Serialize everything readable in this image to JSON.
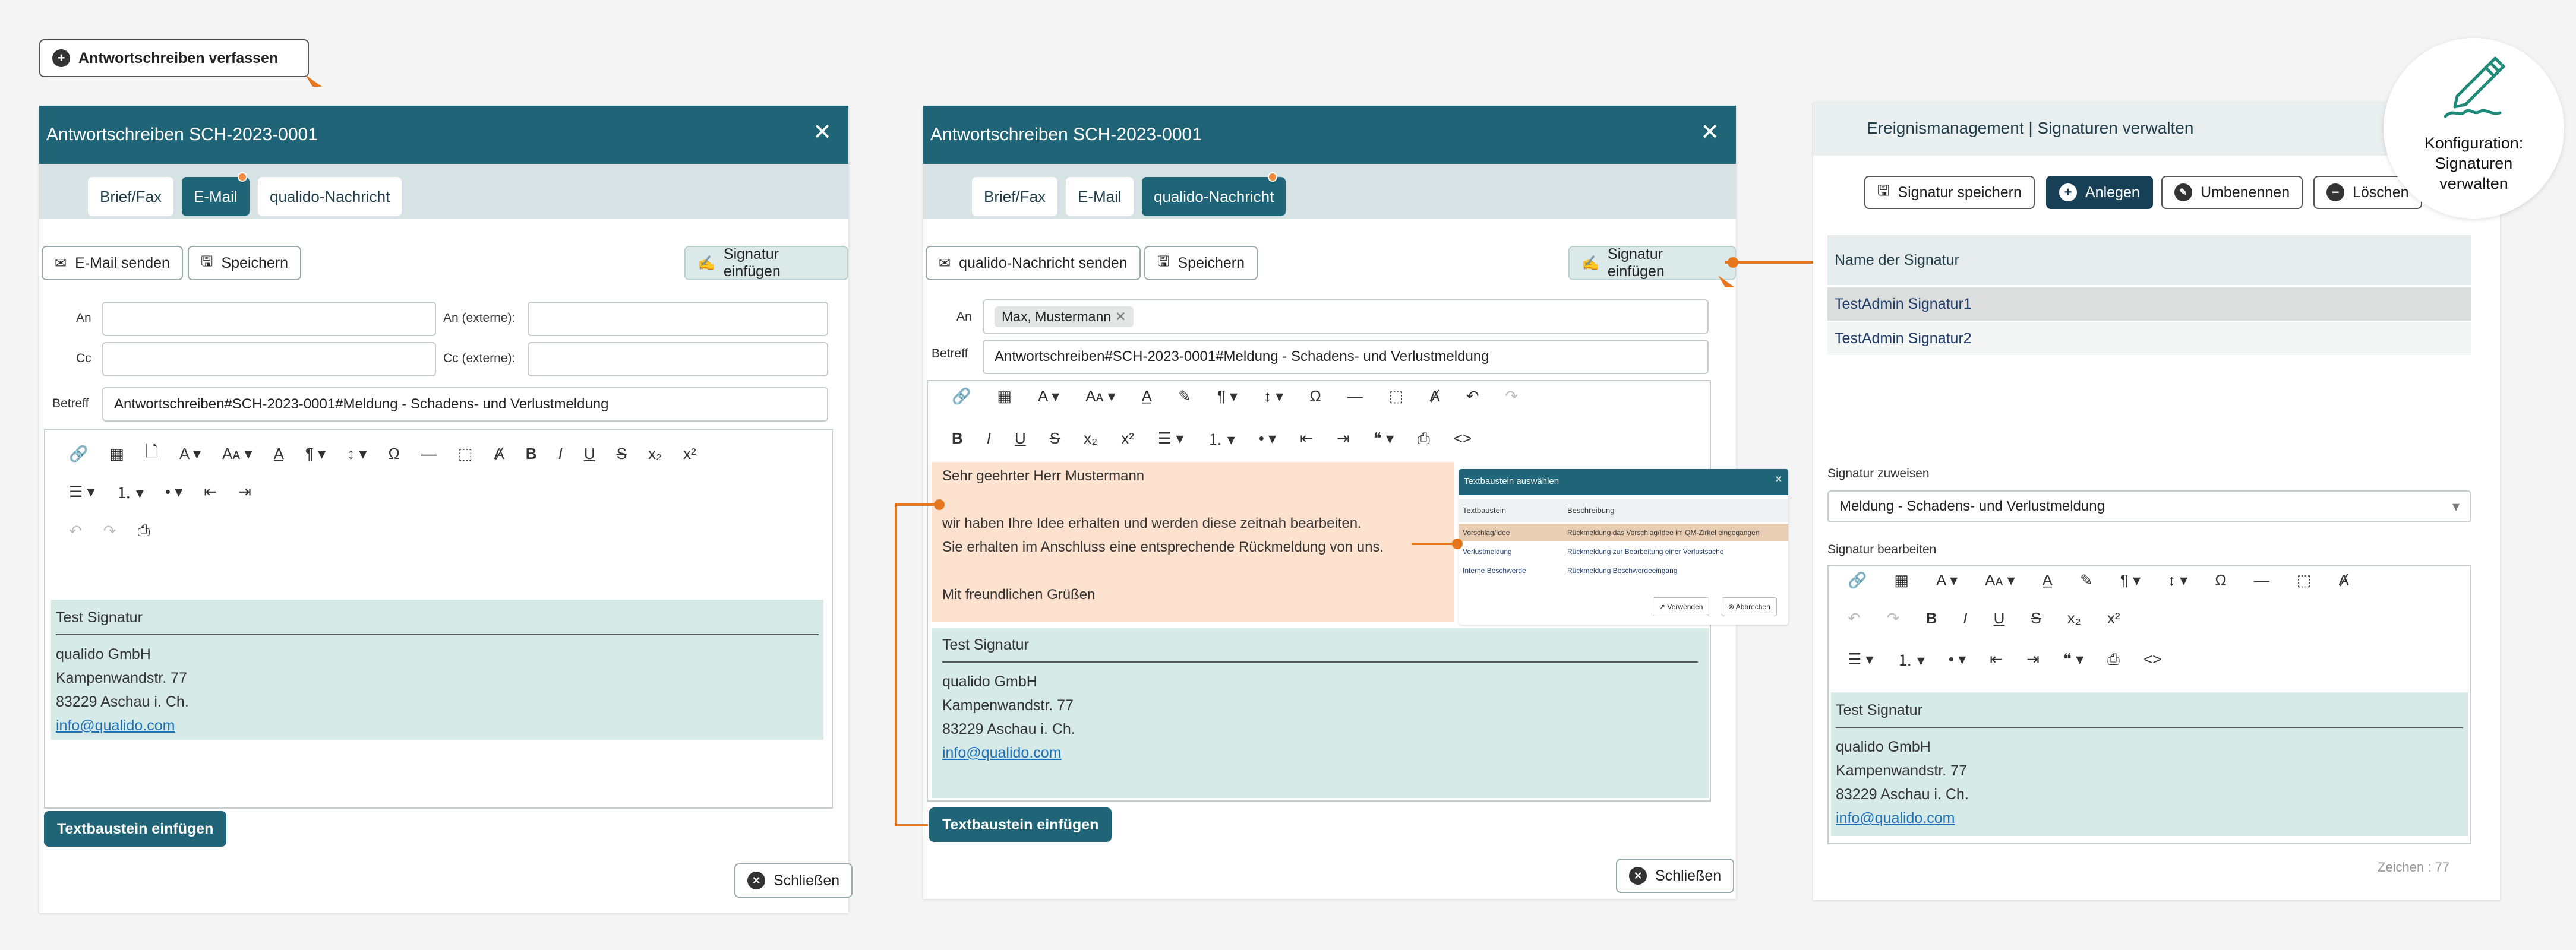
{
  "top_button": {
    "label": "Antwortschreiben verfassen"
  },
  "panel1": {
    "title": "Antwortschreiben SCH-2023-0001",
    "tabs": [
      "Brief/Fax",
      "E-Mail",
      "qualido-Nachricht"
    ],
    "send_label": "E-Mail senden",
    "save_label": "Speichern",
    "signature_label": "Signatur einfügen",
    "fields": {
      "an": "An",
      "an_ext": "An (externe):",
      "cc": "Cc",
      "cc_ext": "Cc (externe):",
      "betreff": "Betreff"
    },
    "betreff_value": "Antwortschreiben#SCH-2023-0001#Meldung - Schadens- und Verlustmeldung",
    "signature": {
      "title": "Test Signatur",
      "company": "qualido GmbH",
      "street": "Kampenwandstr. 77",
      "city": "83229 Aschau i. Ch.",
      "email": "info@qualido.com"
    },
    "textbaustein_label": "Textbaustein einfügen",
    "close_label": "Schließen"
  },
  "panel2": {
    "title": "Antwortschreiben SCH-2023-0001",
    "tabs": [
      "Brief/Fax",
      "E-Mail",
      "qualido-Nachricht"
    ],
    "send_label": "qualido-Nachricht senden",
    "save_label": "Speichern",
    "signature_label": "Signatur einfügen",
    "fields": {
      "an": "An",
      "betreff": "Betreff"
    },
    "recipient_chip": "Max, Mustermann",
    "betreff_value": "Antwortschreiben#SCH-2023-0001#Meldung - Schadens- und Verlustmeldung",
    "body": {
      "greeting": "Sehr geehrter Herr Mustermann",
      "line1": "wir haben Ihre Idee erhalten und werden diese zeitnah bearbeiten.",
      "line2": "Sie erhalten im Anschluss eine entsprechende Rückmeldung von uns.",
      "closing": "Mit freundlichen Grüßen"
    },
    "signature": {
      "title": "Test Signatur",
      "company": "qualido GmbH",
      "street": "Kampenwandstr. 77",
      "city": "83229 Aschau i. Ch.",
      "email": "info@qualido.com"
    },
    "textbaustein_label": "Textbaustein einfügen",
    "close_label": "Schließen"
  },
  "popup": {
    "title": "Textbaustein auswählen",
    "col1": "Textbaustein",
    "col2": "Beschreibung",
    "rows": [
      {
        "name": "Vorschlag/Idee",
        "desc": "Rückmeldung das Vorschlag/Idee im QM-Zirkel eingegangen"
      },
      {
        "name": "Verlustmeldung",
        "desc": "Rückmeldung zur Bearbeitung einer Verlustsache"
      },
      {
        "name": "Interne Beschwerde",
        "desc": "Rückmeldung Beschwerdeeingang"
      }
    ],
    "use_label": "Verwenden",
    "cancel_label": "Abbrechen"
  },
  "panel3": {
    "title": "Ereignismanagement | Signaturen verwalten",
    "save_label": "Signatur speichern",
    "create_label": "Anlegen",
    "rename_label": "Umbenennen",
    "delete_label": "Löschen",
    "list_header": "Name der Signatur",
    "items": [
      "TestAdmin Signatur1",
      "TestAdmin Signatur2"
    ],
    "assign_label": "Signatur zuweisen",
    "assign_value": "Meldung - Schadens- und Verlustmeldung",
    "edit_label": "Signatur bearbeiten",
    "signature": {
      "title": "Test Signatur",
      "company": "qualido GmbH",
      "street": "Kampenwandstr. 77",
      "city": "83229 Aschau i. Ch.",
      "email": "info@qualido.com"
    },
    "char_count": "Zeichen : 77"
  },
  "badge": {
    "line1": "Konfiguration:",
    "line2": "Signaturen",
    "line3": "verwalten"
  },
  "colors": {
    "primary": "#1f6577",
    "accent": "#e8761d",
    "signature_bg": "#d6ebe8",
    "body_highlight": "#fde3cf"
  }
}
